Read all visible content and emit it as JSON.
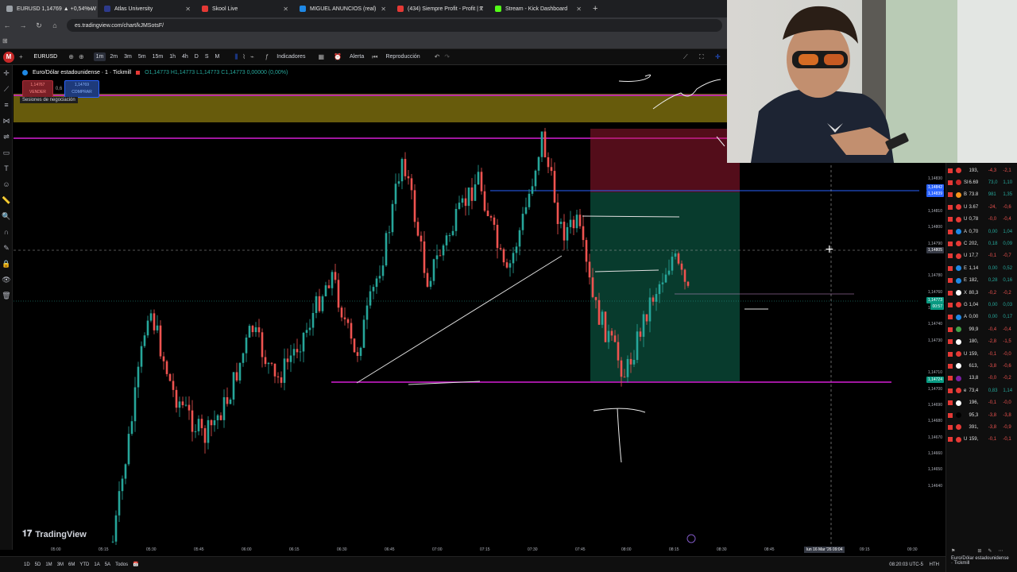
{
  "browser": {
    "tabs": [
      {
        "title": "EURUSD 1,14769 ▲ +0,54% W",
        "color": "#9aa0a6",
        "active": true
      },
      {
        "title": "Atlas University",
        "color": "#2d3a8c",
        "active": false
      },
      {
        "title": "Skool Live",
        "color": "#e53935",
        "active": false
      },
      {
        "title": "MIGUEL ANUNCIOS (real)",
        "color": "#1e88e5",
        "active": false
      },
      {
        "title": "(434) Siempre Profit - Profit | T",
        "color": "#e53935",
        "active": false
      },
      {
        "title": "Stream - Kick Dashboard",
        "color": "#53fc18",
        "active": false
      }
    ],
    "url": "es.tradingview.com/chart/kJMSotsF/",
    "new_tab": "+"
  },
  "toolbar": {
    "symbol": "EURUSD",
    "timeframes": [
      "1m",
      "2m",
      "3m",
      "5m",
      "15m",
      "1h",
      "4h",
      "D",
      "S",
      "M"
    ],
    "selected_timeframe": "1m",
    "indicators": "Indicadores",
    "alert": "Alerta",
    "replay": "Reproducción"
  },
  "legend": {
    "title": "Euro/Dólar estadounidense · 1 · Tickmill",
    "ohlc": "O1,14773 H1,14773 L1,14773 C1,14773 0,00000 (0,00%)",
    "sell_price": "1,14767",
    "sell_label": "VENDER",
    "spread": "0,6",
    "buy_price": "1,14769",
    "buy_label": "COMPRAR",
    "sessions": "Sesiones de negociación"
  },
  "y_axis": {
    "labels": [
      "1,14830",
      "1,14820",
      "1,14810",
      "1,14800",
      "1,14790",
      "1,14780",
      "1,14760",
      "1,14750",
      "1,14740",
      "1,14730",
      "1,14710",
      "1,14700",
      "1,14690",
      "1,14680",
      "1,14670",
      "1,14660",
      "1,14650",
      "1,14640"
    ],
    "tags": [
      {
        "text": "1,14842",
        "color": "#2962ff"
      },
      {
        "text": "1,14839",
        "color": "#2962ff"
      },
      {
        "text": "1,14805",
        "color": "#363a45"
      },
      {
        "text": "1,14773",
        "color": "#089981"
      },
      {
        "text": "00:57",
        "color": "#089981"
      },
      {
        "text": "1,14724",
        "color": "#089981"
      }
    ]
  },
  "x_axis": {
    "labels": [
      "05:00",
      "05:15",
      "05:30",
      "05:45",
      "06:00",
      "06:15",
      "06:30",
      "06:45",
      "07:00",
      "07:15",
      "07:30",
      "07:45",
      "08:00",
      "08:15",
      "08:30",
      "08:45",
      "09:15",
      "09:30"
    ],
    "crosshair": "lun 16 Mar '26  09:04"
  },
  "bottom": {
    "ranges": [
      "1D",
      "5D",
      "1M",
      "3M",
      "6M",
      "YTD",
      "1A",
      "5A",
      "Todos"
    ],
    "clock": "08:20:03 UTC-5",
    "session": "HTH"
  },
  "watermark": "TradingView",
  "watchlist": [
    {
      "n": "",
      "v": "193,",
      "c": "-4,3",
      "p": "-2,1",
      "dot": "#e53935"
    },
    {
      "n": "SI",
      "v": "6.69",
      "c": "73,0",
      "p": "1,10",
      "dot": "#c62828"
    },
    {
      "n": "B",
      "v": "73.8",
      "c": "981",
      "p": "1,35",
      "dot": "#f7931a"
    },
    {
      "n": "U",
      "v": "3.67",
      "c": "-24,",
      "p": "-0,6",
      "dot": "#e53935"
    },
    {
      "n": "U",
      "v": "0,78",
      "c": "-0,0",
      "p": "-0,4",
      "dot": "#e53935"
    },
    {
      "n": "A",
      "v": "0,70",
      "c": "0,00",
      "p": "1,04",
      "dot": "#1e88e5"
    },
    {
      "n": "C",
      "v": "202,",
      "c": "0,18",
      "p": "0,09",
      "dot": "#e53935"
    },
    {
      "n": "U",
      "v": "17,7",
      "c": "-0,1",
      "p": "-0,7",
      "dot": "#e53935"
    },
    {
      "n": "E",
      "v": "1,14",
      "c": "0,00",
      "p": "0,52",
      "dot": "#1e88e5"
    },
    {
      "n": "E",
      "v": "182,",
      "c": "0,28",
      "p": "0,16",
      "dot": "#1e88e5"
    },
    {
      "n": "X",
      "v": "80,3",
      "c": "-0,2",
      "p": "-0,2",
      "dot": "#ffffff"
    },
    {
      "n": "G",
      "v": "1,04",
      "c": "0,00",
      "p": "0,03",
      "dot": "#e53935"
    },
    {
      "n": "A",
      "v": "0,00",
      "c": "0,00",
      "p": "0,17",
      "dot": "#1e88e5"
    },
    {
      "n": "",
      "v": "99,9",
      "c": "-0,4",
      "p": "-0,4",
      "dot": "#43a047"
    },
    {
      "n": "",
      "v": "180,",
      "c": "-2,8",
      "p": "-1,5",
      "dot": "#ffffff"
    },
    {
      "n": "U",
      "v": "159,",
      "c": "-0,1",
      "p": "-0,0",
      "dot": "#e53935"
    },
    {
      "n": "",
      "v": "613,",
      "c": "-3,8",
      "p": "-0,6",
      "dot": "#ffffff"
    },
    {
      "n": "",
      "v": "13,8",
      "c": "-0,0",
      "p": "-0,2",
      "dot": "#7b1fa2"
    },
    {
      "n": "e",
      "v": "73,4",
      "c": "0,83",
      "p": "1,14",
      "dot": "#e53935"
    },
    {
      "n": "",
      "v": "196,",
      "c": "-0,1",
      "p": "-0,0",
      "dot": "#ffffff"
    },
    {
      "n": "",
      "v": "95,3",
      "c": "-3,8",
      "p": "-3,8",
      "dot": "#000000"
    },
    {
      "n": "",
      "v": "391,",
      "c": "-3,8",
      "p": "-0,9",
      "dot": "#e53935"
    },
    {
      "n": "U",
      "v": "159,",
      "c": "-0,1",
      "p": "-0,1",
      "dot": "#e53935"
    }
  ],
  "detail": {
    "name": "Euro/Dólar estadounidense",
    "broker": "· Tickmill"
  },
  "colors": {
    "up": "#26a69a",
    "down": "#ef5350",
    "magenta_line": "#d61fd6",
    "session_band": "#8a7a10"
  }
}
